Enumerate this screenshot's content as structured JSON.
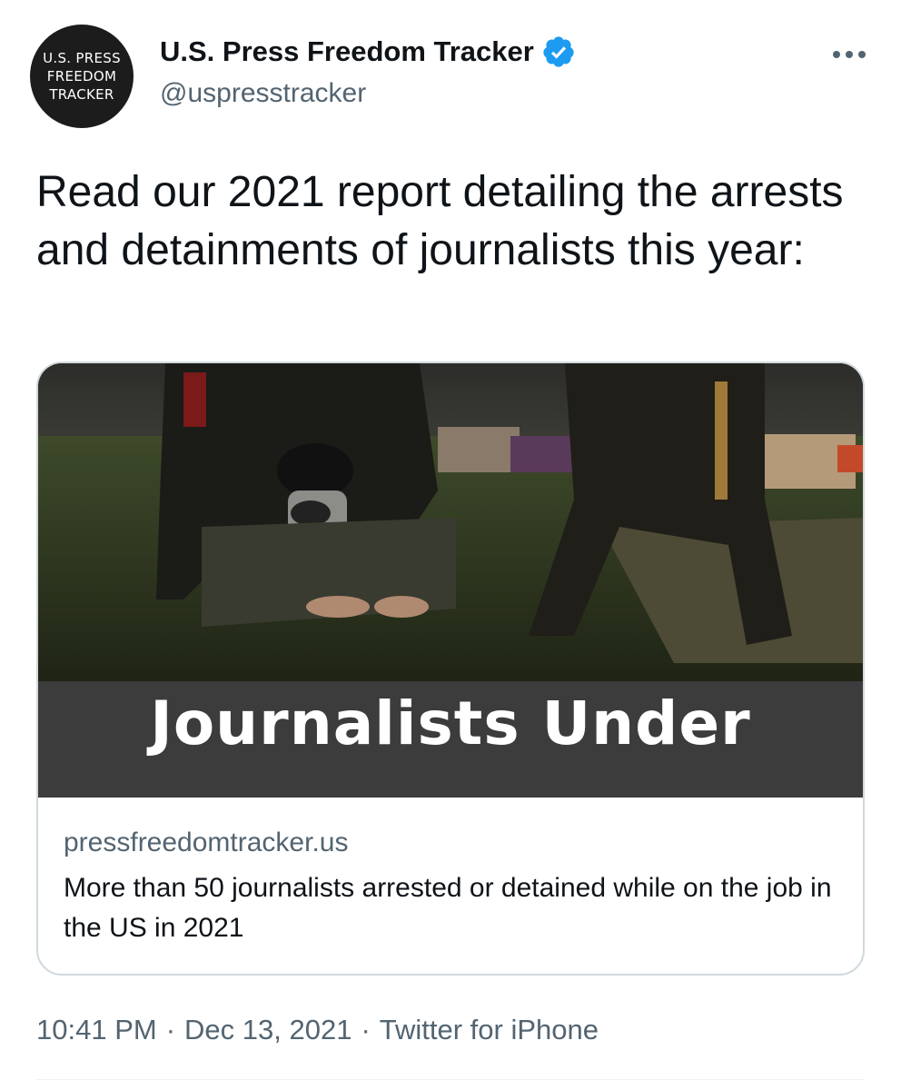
{
  "author": {
    "avatar_lines": [
      "U.S. PRESS",
      "FREEDOM",
      "TRACKER"
    ],
    "display_name": "U.S. Press Freedom Tracker",
    "handle": "@uspresstracker",
    "verified": true
  },
  "tweet": {
    "text": "Read our 2021 report detailing the arrests and detainments of journalists this year:"
  },
  "card": {
    "image_banner_text": "Journalists Under",
    "domain": "pressfreedomtracker.us",
    "description": "More than 50 journalists arrested or detained while on the job in the US in 2021"
  },
  "meta": {
    "time": "10:41 PM",
    "separator": "·",
    "date": "Dec 13, 2021",
    "source": "Twitter for iPhone"
  },
  "colors": {
    "verified_blue": "#1d9bf0",
    "secondary_text": "#536471",
    "card_border": "#cfd9de"
  }
}
